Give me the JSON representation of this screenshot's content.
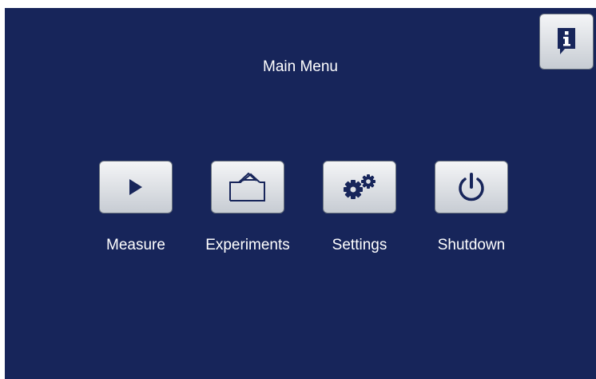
{
  "header": {
    "title": "Main Menu"
  },
  "info_button": {
    "icon": "info-icon"
  },
  "menu": {
    "items": [
      {
        "label": "Measure",
        "icon": "play-icon"
      },
      {
        "label": "Experiments",
        "icon": "folder-icon"
      },
      {
        "label": "Settings",
        "icon": "gears-icon"
      },
      {
        "label": "Shutdown",
        "icon": "power-icon"
      }
    ]
  },
  "colors": {
    "background": "#17255a",
    "icon": "#17255a",
    "button_face": "#e4e7eb",
    "text": "#ffffff"
  }
}
